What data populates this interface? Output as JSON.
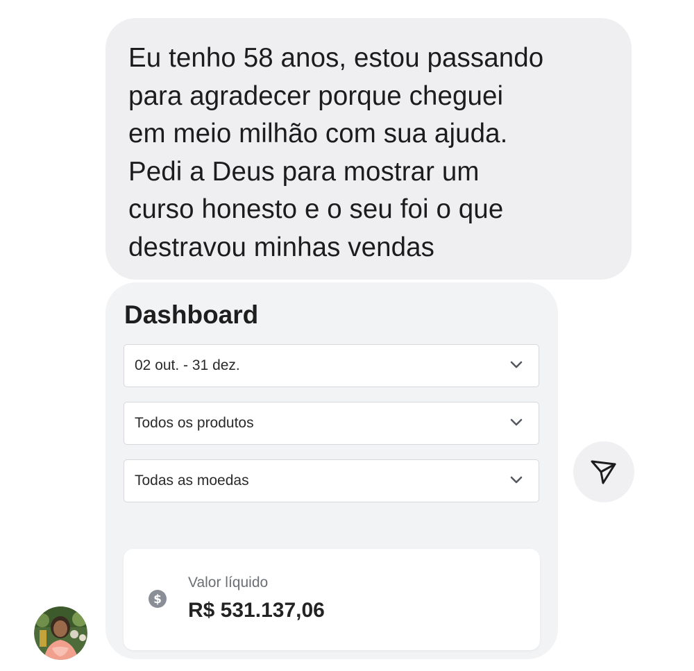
{
  "message": {
    "text": "Eu tenho 58 anos, estou passando\npara agradecer porque cheguei\nem meio milhão com sua ajuda.\nPedi a Deus para mostrar um\ncurso honesto e o seu foi o que\ndestravou minhas vendas"
  },
  "dashboard": {
    "title": "Dashboard",
    "filters": {
      "date_range": "02 out. - 31 dez.",
      "products": "Todos os produtos",
      "currencies": "Todas as moedas"
    },
    "net_value": {
      "label": "Valor líquido",
      "amount": "R$ 531.137,06",
      "icon": "dollar-circle-icon"
    }
  },
  "actions": {
    "share_icon": "send-arrow-icon"
  },
  "colors": {
    "bubble_bg": "#efeff1",
    "dashboard_bg": "#f2f3f5",
    "icon_gray": "#8a8e96"
  }
}
